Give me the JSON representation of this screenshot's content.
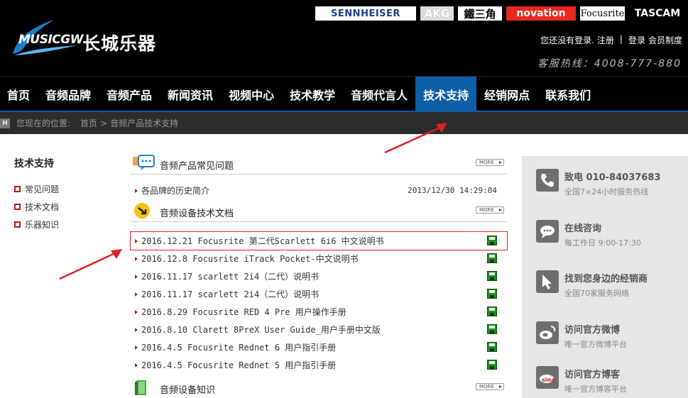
{
  "header": {
    "logo_en": "MUSICGW",
    "logo_cn": "长城乐器",
    "brands": [
      "SENNHEISER",
      "AKG",
      "鐵三角",
      "novation",
      "Focusrite",
      "TASCAM"
    ],
    "user_links": {
      "not_logged": "您还没有登录.",
      "register": "注册",
      "sep": "|",
      "login": "登录",
      "member_policy": "会员制度"
    },
    "hotline": "客服热线：4008-777-880"
  },
  "nav": {
    "items": [
      "首页",
      "音频品牌",
      "音频产品",
      "新闻资讯",
      "视频中心",
      "技术教学",
      "音频代言人",
      "技术支持",
      "经销网点",
      "联系我们"
    ],
    "active_index": 7
  },
  "breadcrumb": {
    "icon": "H",
    "prefix": "您现在的位置:",
    "home": "首页",
    "sep": ">",
    "current": "音频产品技术支持"
  },
  "sidebar": {
    "title": "技术支持",
    "items": [
      "常见问题",
      "技术文档",
      "乐器知识"
    ]
  },
  "sections": [
    {
      "title": "音频产品常见问题",
      "more": "MORE",
      "icon": "chat-bubble-icon",
      "rows": [
        {
          "text": "各品牌的历史简介",
          "date": "2013/12/30 14:29:04"
        }
      ]
    },
    {
      "title": "音频设备技术文档",
      "more": "MORE",
      "icon": "download-arrow-icon",
      "rows": [
        {
          "text": "2016.12.21 Focusrite 第二代Scarlett 6i6 中文说明书"
        },
        {
          "text": "2016.12.8 Focusrite iTrack Pocket-中文说明书"
        },
        {
          "text": "2016.11.17 scarlett 2i4（二代）说明书"
        },
        {
          "text": "2016.11.17 scarlett 2i4（二代）说明书"
        },
        {
          "text": "2016.8.29 Focusrite RED 4 Pre 用户操作手册"
        },
        {
          "text": "2016.8.10 Clarett 8PreX User Guide_用户手册中文版"
        },
        {
          "text": "2016.4.5 Focusrite Rednet 6 用户指引手册"
        },
        {
          "text": "2016.4.5 Focusrite Rednet 5 用户指引手册"
        }
      ]
    },
    {
      "title": "音频设备知识",
      "more": "MORE",
      "icon": "book-icon",
      "rows": []
    }
  ],
  "right_panel": [
    {
      "title": "致电  010-84037683",
      "sub": "全国7×24小时服务热线",
      "icon": "phone-icon"
    },
    {
      "title": "在线咨询",
      "sub": "每工作日 9:00-17:30",
      "icon": "chat-icon"
    },
    {
      "title": "找到您身边的经销商",
      "sub": "全国70家服务网络",
      "icon": "cursor-icon"
    },
    {
      "title": "访问官方微博",
      "sub": "唯一官方微博平台",
      "icon": "weibo-icon"
    },
    {
      "title": "访问官方博客",
      "sub": "唯一官方博客平台",
      "icon": "sina-blog-icon"
    }
  ],
  "colors": {
    "accent": "#0f5fa6",
    "marker": "#c0171b",
    "highlight_box": "#e02020"
  }
}
